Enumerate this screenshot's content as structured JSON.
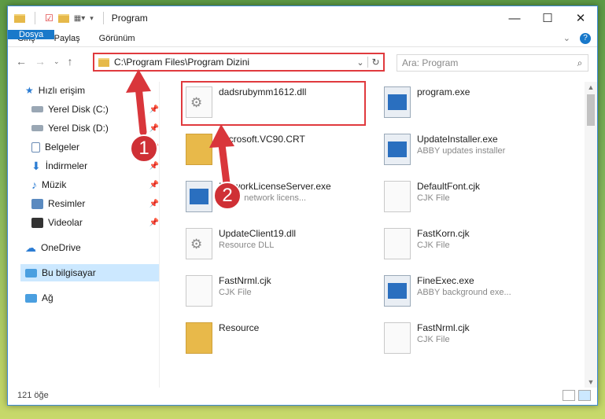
{
  "window": {
    "title": "Program"
  },
  "ribbon": {
    "tabs": [
      "Dosya",
      "Giriş",
      "Paylaş",
      "Görünüm"
    ]
  },
  "address": {
    "path": "C:\\Program Files\\Program Dizini"
  },
  "search": {
    "placeholder": "Ara: Program"
  },
  "sidebar": {
    "quick": "Hızlı erişim",
    "items": [
      "Yerel Disk (C:)",
      "Yerel Disk (D:)",
      "Belgeler",
      "İndirmeler",
      "Müzik",
      "Resimler",
      "Videolar"
    ],
    "onedrive": "OneDrive",
    "thispc": "Bu bilgisayar",
    "network": "Ağ"
  },
  "files": [
    {
      "name": "dadsrubymm1612.dll",
      "sub": ""
    },
    {
      "name": "program.exe",
      "sub": ""
    },
    {
      "name": "Microsoft.VC90.CRT",
      "sub": ""
    },
    {
      "name": "UpdateInstaller.exe",
      "sub": "ABBY updates installer"
    },
    {
      "name": "NetworkLicenseServer.exe",
      "sub": "ABBY network licens..."
    },
    {
      "name": "DefaultFont.cjk",
      "sub": "CJK File"
    },
    {
      "name": "UpdateClient19.dll",
      "sub": "Resource DLL"
    },
    {
      "name": "FastKorn.cjk",
      "sub": "CJK File"
    },
    {
      "name": "FastNrml.cjk",
      "sub": "CJK File"
    },
    {
      "name": "FineExec.exe",
      "sub": "ABBY background exe..."
    },
    {
      "name": "Resource",
      "sub": ""
    },
    {
      "name": "FastNrml.cjk",
      "sub": "CJK File"
    }
  ],
  "status": {
    "count": "121 öğe"
  },
  "annotations": {
    "step1": "1",
    "step2": "2"
  },
  "colors": {
    "accent": "#1979ca",
    "highlight": "#e03a3e"
  }
}
